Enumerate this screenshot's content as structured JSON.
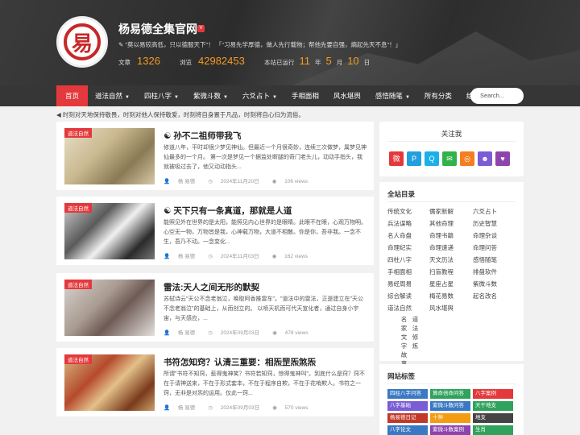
{
  "header": {
    "logo_glyph": "易",
    "title": "杨易德全集官网",
    "badge": "V",
    "motto": "\"莫以易较高低，只以德服天下\"！  「\"习易先学厚德，做人先行载物；帮他先要自强，熵起先天不息\"！」",
    "stats": {
      "articles_label": "文章",
      "articles_value": "1326",
      "views_label": "浏览",
      "views_value": "42982453",
      "run_label": "本站已运行",
      "years": "11",
      "years_unit": "年",
      "months": "5",
      "months_unit": "月",
      "days": "10",
      "days_unit": "日"
    }
  },
  "nav": {
    "items": [
      {
        "label": "首页",
        "dropdown": false
      },
      {
        "label": "道法自然",
        "dropdown": true
      },
      {
        "label": "四柱八字",
        "dropdown": true
      },
      {
        "label": "紫微斗数",
        "dropdown": true
      },
      {
        "label": "六爻占卜",
        "dropdown": true
      },
      {
        "label": "手相面相",
        "dropdown": false
      },
      {
        "label": "风水堪舆",
        "dropdown": false
      },
      {
        "label": "感悟随笔",
        "dropdown": true
      },
      {
        "label": "所有分类",
        "dropdown": false
      },
      {
        "label": "给我留言",
        "dropdown": false
      }
    ],
    "caret": "▼",
    "search_placeholder": "Search..."
  },
  "notice": "时刻对天地保持敬畏，时刻对他人保持敬爱，时刻将自身置于凡品，时刻将自心归为流俗。",
  "posts": [
    {
      "tag": "道法自然",
      "title": "孙不二祖师带我飞",
      "excerpt": "修道八年，平时却很少梦见神仙。但最近一个月很奇妙，连续三次做梦，属梦见神仙最多的一个月。 第一次是梦见一个据监处断腿的奇门老头儿，动动手指头，我就被吸过去了，他又动动指头...",
      "author": "杨 易德",
      "date": "2024年11月20日",
      "views": "106 views"
    },
    {
      "tag": "道法自然",
      "title": "天下只有一条真道，那就是人道",
      "excerpt": "能照见外在世界的是太阳，能照见内心世界的是眼睛。此眼不在眼，心观万物明。 心空无一物，万物皆是我，心神载万物，大道不相散。你是你，吾非我。一念不生，吾乃不动。一念变化...",
      "author": "杨 易德",
      "date": "2024年11月03日",
      "views": "162 views"
    },
    {
      "tag": "道法自然",
      "title": "雷法:天人之间无形的默契",
      "excerpt": "苏轼诗云\"天公不念老翁泣，唤取阿香推雷车\"。\"道法中的雷法，正是建立在\"天公不念老翁泣\"的基础上，从而创立的。 以喷天机而可代天宣化者，通过自身小宇宙，与天感应，...",
      "author": "杨 易德",
      "date": "2024年09月03日",
      "views": "478 views"
    },
    {
      "tag": "道法自然",
      "title": "书符怎知窍？认清三重要：相炁罡炁煞炁",
      "excerpt": "所谓\"书符不知窍，惹得鬼神笑？书符若知窍，惊得鬼神叫\"。到底什么是窍？窍不在于请神送来，不在于形式套本，不在于程序自欺，不在于花哨欺人。书符之一窍，无非是对炁的运用。仅此一窍...",
      "author": "杨 易德",
      "date": "2024年09月03日",
      "views": "570 views"
    }
  ],
  "follow": {
    "title": "关注我",
    "icons": [
      "weibo-icon",
      "pinterest-icon",
      "qq-icon",
      "wechat-icon",
      "rss-icon",
      "group-icon",
      "like-icon"
    ],
    "colors": [
      "#e4393c",
      "#20a0e0",
      "#1ab0e8",
      "#2fb34a",
      "#f47e20",
      "#7a5cd6",
      "#8e44ad"
    ]
  },
  "directory": {
    "title": "全站目录",
    "col1": [
      "传统文化",
      "兵法谋略",
      "名人命盘",
      "命理纪实",
      "四柱八字",
      "手相面相",
      "易经周易",
      "综合解读",
      "道法自然"
    ],
    "col2": [
      "儒家新解",
      "其他命理",
      "命理书籍",
      "命理速递",
      "天文历法",
      "扫盲教程",
      "星座占星",
      "梅花易数",
      "风水堪舆"
    ],
    "col3": [
      "六爻占卜",
      "历史智慧",
      "命理杂谈",
      "命理问答",
      "感悟随笔",
      "排盘软件",
      "紫微斗数",
      "起名改名"
    ],
    "vert1": "名家文字故事",
    "vert2": "道法修炼"
  },
  "tags": {
    "title": "网站标签",
    "items": [
      {
        "label": "四柱八字问答",
        "color": "#3a78c3"
      },
      {
        "label": "算命倍命问答",
        "color": "#2fa35b"
      },
      {
        "label": "八字案例",
        "color": "#e4393c"
      },
      {
        "label": "八字基础",
        "color": "#7a5cd6"
      },
      {
        "label": "紫微斗数问答",
        "color": "#3a78c3"
      },
      {
        "label": "天干地支",
        "color": "#2fa35b"
      },
      {
        "label": "杨易德日记",
        "color": "#c0392b"
      },
      {
        "label": "十神",
        "color": "#f39c12"
      },
      {
        "label": "地支",
        "color": "#444444"
      },
      {
        "label": "八字论文",
        "color": "#3a78c3"
      },
      {
        "label": "紫微斗数案例",
        "color": "#8e44ad"
      },
      {
        "label": "生肖",
        "color": "#2fa35b"
      }
    ]
  }
}
